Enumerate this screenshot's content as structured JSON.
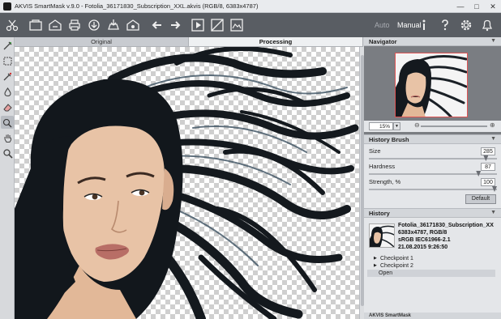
{
  "window": {
    "title": "AKVIS SmartMask v.9.0 - Fotolia_36171830_Subscription_XXL.akvis (RGB/8, 6383x4787)",
    "controls": [
      "minimize-icon",
      "maximize-icon",
      "close-icon"
    ]
  },
  "toolbar": {
    "icons": [
      "scissors-icon",
      "open-image-icon",
      "save-icon",
      "print-icon",
      "share-icon",
      "export-icon",
      "save-as-icon",
      "undo-icon",
      "redo-icon",
      "run-icon",
      "transparency-icon",
      "preview-icon"
    ],
    "mode_auto": "Auto",
    "mode_manual": "Manual",
    "right_icons": [
      "info-icon",
      "help-icon",
      "settings-icon",
      "notifications-icon"
    ]
  },
  "left_tools": [
    "magic-brush-icon",
    "rect-selection-icon",
    "magic-tube-icon",
    "drop-icon",
    "eraser-icon",
    "history-brush-icon",
    "hand-icon",
    "zoom-icon"
  ],
  "tabs": {
    "original": "Original",
    "processing": "Processing"
  },
  "navigator": {
    "title": "Navigator",
    "zoom": "15%"
  },
  "history_brush": {
    "title": "History Brush",
    "size_label": "Size",
    "size_value": "285",
    "size_fraction": 0.93,
    "hardness_label": "Hardness",
    "hardness_value": "87",
    "hardness_fraction": 0.87,
    "strength_label": "Strength, %",
    "strength_value": "100",
    "strength_fraction": 1.0,
    "default_button": "Default"
  },
  "history": {
    "title": "History",
    "item": {
      "line1": "Fotolia_36171830_Subscription_XX",
      "line2": "6383x4787, RGB/8",
      "line3": "sRGB IEC61966-2.1",
      "line4": "21.08.2015 9:26:50"
    },
    "checkpoint1": "Checkpoint 1",
    "checkpoint2": "Checkpoint 2",
    "open": "Open"
  },
  "footer": {
    "label": "AKVIS SmartMask"
  }
}
